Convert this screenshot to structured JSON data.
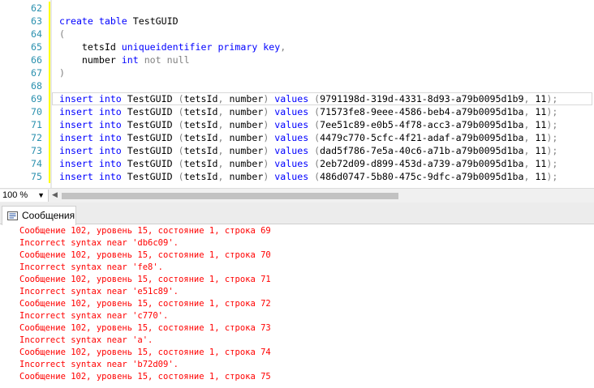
{
  "editor": {
    "lines": [
      {
        "num": "62",
        "segments": []
      },
      {
        "num": "63",
        "segments": [
          {
            "t": "create table ",
            "c": "kw"
          },
          {
            "t": "TestGUID",
            "c": ""
          }
        ]
      },
      {
        "num": "64",
        "segments": [
          {
            "t": "(",
            "c": "gray"
          }
        ]
      },
      {
        "num": "65",
        "segments": [
          {
            "t": "    tetsId ",
            "c": ""
          },
          {
            "t": "uniqueidentifier primary key",
            "c": "kw"
          },
          {
            "t": ",",
            "c": "gray"
          }
        ]
      },
      {
        "num": "66",
        "segments": [
          {
            "t": "    number ",
            "c": ""
          },
          {
            "t": "int ",
            "c": "kw"
          },
          {
            "t": "not null",
            "c": "gray"
          }
        ]
      },
      {
        "num": "67",
        "segments": [
          {
            "t": ")",
            "c": "gray"
          }
        ]
      },
      {
        "num": "68",
        "segments": []
      },
      {
        "num": "69",
        "segments": [
          {
            "t": "insert into ",
            "c": "kw"
          },
          {
            "t": "TestGUID ",
            "c": ""
          },
          {
            "t": "(",
            "c": "gray"
          },
          {
            "t": "tetsId",
            "c": ""
          },
          {
            "t": ", ",
            "c": "gray"
          },
          {
            "t": "number",
            "c": ""
          },
          {
            "t": ") ",
            "c": "gray"
          },
          {
            "t": "values ",
            "c": "kw"
          },
          {
            "t": "(",
            "c": "gray"
          },
          {
            "t": "9791198d-319d-4331-8d93-a79b0095d1b9",
            "c": ""
          },
          {
            "t": ", ",
            "c": "gray"
          },
          {
            "t": "11",
            "c": ""
          },
          {
            "t": ");",
            "c": "gray"
          }
        ]
      },
      {
        "num": "70",
        "segments": [
          {
            "t": "insert into ",
            "c": "kw"
          },
          {
            "t": "TestGUID ",
            "c": ""
          },
          {
            "t": "(",
            "c": "gray"
          },
          {
            "t": "tetsId",
            "c": ""
          },
          {
            "t": ", ",
            "c": "gray"
          },
          {
            "t": "number",
            "c": ""
          },
          {
            "t": ") ",
            "c": "gray"
          },
          {
            "t": "values ",
            "c": "kw"
          },
          {
            "t": "(",
            "c": "gray"
          },
          {
            "t": "71573fe8-9eee-4586-beb4-a79b0095d1ba",
            "c": ""
          },
          {
            "t": ", ",
            "c": "gray"
          },
          {
            "t": "11",
            "c": ""
          },
          {
            "t": ");",
            "c": "gray"
          }
        ]
      },
      {
        "num": "71",
        "segments": [
          {
            "t": "insert into ",
            "c": "kw"
          },
          {
            "t": "TestGUID ",
            "c": ""
          },
          {
            "t": "(",
            "c": "gray"
          },
          {
            "t": "tetsId",
            "c": ""
          },
          {
            "t": ", ",
            "c": "gray"
          },
          {
            "t": "number",
            "c": ""
          },
          {
            "t": ") ",
            "c": "gray"
          },
          {
            "t": "values ",
            "c": "kw"
          },
          {
            "t": "(",
            "c": "gray"
          },
          {
            "t": "7ee51c89-e0b5-4f78-acc3-a79b0095d1ba",
            "c": ""
          },
          {
            "t": ", ",
            "c": "gray"
          },
          {
            "t": "11",
            "c": ""
          },
          {
            "t": ");",
            "c": "gray"
          }
        ]
      },
      {
        "num": "72",
        "segments": [
          {
            "t": "insert into ",
            "c": "kw"
          },
          {
            "t": "TestGUID ",
            "c": ""
          },
          {
            "t": "(",
            "c": "gray"
          },
          {
            "t": "tetsId",
            "c": ""
          },
          {
            "t": ", ",
            "c": "gray"
          },
          {
            "t": "number",
            "c": ""
          },
          {
            "t": ") ",
            "c": "gray"
          },
          {
            "t": "values ",
            "c": "kw"
          },
          {
            "t": "(",
            "c": "gray"
          },
          {
            "t": "4479c770-5cfc-4f21-adaf-a79b0095d1ba",
            "c": ""
          },
          {
            "t": ", ",
            "c": "gray"
          },
          {
            "t": "11",
            "c": ""
          },
          {
            "t": ");",
            "c": "gray"
          }
        ]
      },
      {
        "num": "73",
        "segments": [
          {
            "t": "insert into ",
            "c": "kw"
          },
          {
            "t": "TestGUID ",
            "c": ""
          },
          {
            "t": "(",
            "c": "gray"
          },
          {
            "t": "tetsId",
            "c": ""
          },
          {
            "t": ", ",
            "c": "gray"
          },
          {
            "t": "number",
            "c": ""
          },
          {
            "t": ") ",
            "c": "gray"
          },
          {
            "t": "values ",
            "c": "kw"
          },
          {
            "t": "(",
            "c": "gray"
          },
          {
            "t": "dad5f786-7e5a-40c6-a71b-a79b0095d1ba",
            "c": ""
          },
          {
            "t": ", ",
            "c": "gray"
          },
          {
            "t": "11",
            "c": ""
          },
          {
            "t": ");",
            "c": "gray"
          }
        ]
      },
      {
        "num": "74",
        "segments": [
          {
            "t": "insert into ",
            "c": "kw"
          },
          {
            "t": "TestGUID ",
            "c": ""
          },
          {
            "t": "(",
            "c": "gray"
          },
          {
            "t": "tetsId",
            "c": ""
          },
          {
            "t": ", ",
            "c": "gray"
          },
          {
            "t": "number",
            "c": ""
          },
          {
            "t": ") ",
            "c": "gray"
          },
          {
            "t": "values ",
            "c": "kw"
          },
          {
            "t": "(",
            "c": "gray"
          },
          {
            "t": "2eb72d09-d899-453d-a739-a79b0095d1ba",
            "c": ""
          },
          {
            "t": ", ",
            "c": "gray"
          },
          {
            "t": "11",
            "c": ""
          },
          {
            "t": ");",
            "c": "gray"
          }
        ]
      },
      {
        "num": "75",
        "segments": [
          {
            "t": "insert into ",
            "c": "kw"
          },
          {
            "t": "TestGUID ",
            "c": ""
          },
          {
            "t": "(",
            "c": "gray"
          },
          {
            "t": "tetsId",
            "c": ""
          },
          {
            "t": ", ",
            "c": "gray"
          },
          {
            "t": "number",
            "c": ""
          },
          {
            "t": ") ",
            "c": "gray"
          },
          {
            "t": "values ",
            "c": "kw"
          },
          {
            "t": "(",
            "c": "gray"
          },
          {
            "t": "486d0747-5b80-475c-9dfc-a79b0095d1ba",
            "c": ""
          },
          {
            "t": ", ",
            "c": "gray"
          },
          {
            "t": "11",
            "c": ""
          },
          {
            "t": ");",
            "c": "gray"
          }
        ]
      }
    ]
  },
  "zoombar": {
    "zoom": "100 %"
  },
  "results": {
    "tab_label": "Сообщения",
    "messages": [
      "Сообщение 102, уровень 15, состояние 1, строка 69",
      "Incorrect syntax near 'db6c09'.",
      "Сообщение 102, уровень 15, состояние 1, строка 70",
      "Incorrect syntax near 'fe8'.",
      "Сообщение 102, уровень 15, состояние 1, строка 71",
      "Incorrect syntax near 'e51c89'.",
      "Сообщение 102, уровень 15, состояние 1, строка 72",
      "Incorrect syntax near 'c770'.",
      "Сообщение 102, уровень 15, состояние 1, строка 73",
      "Incorrect syntax near 'a'.",
      "Сообщение 102, уровень 15, состояние 1, строка 74",
      "Incorrect syntax near 'b72d09'.",
      "Сообщение 102, уровень 15, состояние 1, строка 75"
    ]
  },
  "colors": {
    "keyword": "#0000ff",
    "line_number": "#2b91af",
    "error": "#ff0000",
    "punctuation": "#808080"
  },
  "icons": {
    "messages_tab": "messages-icon",
    "zoom_dropdown": "chevron-down-icon",
    "scroll_left": "arrow-left-icon"
  }
}
